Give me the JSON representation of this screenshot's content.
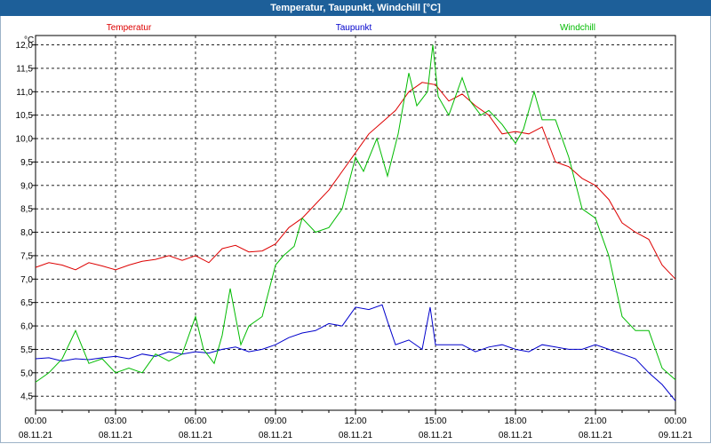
{
  "window": {
    "title": "Temperatur, Taupunkt, Windchill [°C]"
  },
  "chart_data": {
    "type": "line",
    "title": "Temperatur, Taupunkt, Windchill [°C]",
    "ylabel": "°C",
    "ylim": [
      4.2,
      12.2
    ],
    "y_ticks": [
      "4,5",
      "5,0",
      "5,5",
      "6,0",
      "6,5",
      "7,0",
      "7,5",
      "8,0",
      "8,5",
      "9,0",
      "9,5",
      "10,0",
      "10,5",
      "11,0",
      "11,5",
      "12,0"
    ],
    "x_hours_range": [
      0,
      24
    ],
    "x_ticks": [
      {
        "time": "00:00",
        "date": "08.11.21"
      },
      {
        "time": "03:00",
        "date": "08.11.21"
      },
      {
        "time": "06:00",
        "date": "08.11.21"
      },
      {
        "time": "09:00",
        "date": "08.11.21"
      },
      {
        "time": "12:00",
        "date": "08.11.21"
      },
      {
        "time": "15:00",
        "date": "08.11.21"
      },
      {
        "time": "18:00",
        "date": "08.11.21"
      },
      {
        "time": "21:00",
        "date": "08.11.21"
      },
      {
        "time": "00:00",
        "date": "09.11.21"
      }
    ],
    "grid": true,
    "legend_position": "top",
    "series": [
      {
        "name": "Temperatur",
        "color": "#dd0000",
        "x": [
          0,
          0.5,
          1,
          1.5,
          2,
          2.5,
          3,
          3.5,
          4,
          4.5,
          5,
          5.5,
          6,
          6.5,
          7,
          7.5,
          8,
          8.5,
          9,
          9.5,
          10,
          10.5,
          11,
          11.5,
          12,
          12.5,
          13,
          13.5,
          14,
          14.5,
          15,
          15.5,
          16,
          16.5,
          17,
          17.5,
          18,
          18.5,
          19,
          19.5,
          20,
          20.5,
          21,
          21.5,
          22,
          22.5,
          23,
          23.5,
          24
        ],
        "values": [
          7.25,
          7.35,
          7.3,
          7.2,
          7.35,
          7.28,
          7.2,
          7.3,
          7.38,
          7.42,
          7.5,
          7.4,
          7.5,
          7.35,
          7.65,
          7.72,
          7.58,
          7.6,
          7.75,
          8.1,
          8.3,
          8.6,
          8.9,
          9.3,
          9.7,
          10.1,
          10.35,
          10.6,
          11.0,
          11.2,
          11.15,
          10.8,
          10.95,
          10.7,
          10.5,
          10.1,
          10.15,
          10.1,
          10.25,
          9.5,
          9.4,
          9.15,
          9.0,
          8.7,
          8.2,
          8.0,
          7.85,
          7.3,
          7.0
        ]
      },
      {
        "name": "Taupunkt",
        "color": "#0000cc",
        "x": [
          0,
          0.5,
          1,
          1.5,
          2,
          2.5,
          3,
          3.5,
          4,
          4.5,
          5,
          5.5,
          6,
          6.5,
          7,
          7.5,
          8,
          8.5,
          9,
          9.5,
          10,
          10.5,
          11,
          11.5,
          12,
          12.5,
          13,
          13.2,
          13.5,
          14,
          14.5,
          14.8,
          15,
          15.5,
          16,
          16.5,
          17,
          17.5,
          18,
          18.5,
          19,
          19.5,
          20,
          20.5,
          21,
          21.5,
          22,
          22.5,
          23,
          23.5,
          24
        ],
        "values": [
          5.3,
          5.32,
          5.25,
          5.3,
          5.28,
          5.32,
          5.35,
          5.3,
          5.4,
          5.35,
          5.45,
          5.4,
          5.45,
          5.42,
          5.5,
          5.55,
          5.45,
          5.5,
          5.6,
          5.75,
          5.85,
          5.9,
          6.05,
          6.0,
          6.4,
          6.35,
          6.45,
          6.1,
          5.6,
          5.7,
          5.5,
          6.4,
          5.6,
          5.6,
          5.6,
          5.45,
          5.55,
          5.6,
          5.5,
          5.45,
          5.6,
          5.55,
          5.5,
          5.5,
          5.6,
          5.5,
          5.4,
          5.3,
          5.0,
          4.75,
          4.4
        ]
      },
      {
        "name": "Windchill",
        "color": "#00bb00",
        "x": [
          0,
          0.5,
          1,
          1.5,
          2,
          2.5,
          3,
          3.5,
          4,
          4.5,
          5,
          5.5,
          6,
          6.3,
          6.7,
          7,
          7.3,
          7.7,
          8,
          8.5,
          9,
          9.3,
          9.7,
          10,
          10.5,
          11,
          11.5,
          12,
          12.3,
          12.8,
          13.2,
          13.6,
          14,
          14.3,
          14.7,
          14.9,
          15.1,
          15.5,
          16,
          16.3,
          16.7,
          17,
          17.5,
          18,
          18.3,
          18.7,
          19,
          19.5,
          20,
          20.5,
          21,
          21.5,
          22,
          22.5,
          23,
          23.5,
          24
        ],
        "values": [
          4.8,
          5.0,
          5.3,
          5.9,
          5.2,
          5.3,
          5.0,
          5.1,
          5.0,
          5.4,
          5.25,
          5.4,
          6.2,
          5.5,
          5.2,
          5.8,
          6.8,
          5.6,
          6.0,
          6.2,
          7.3,
          7.5,
          7.7,
          8.3,
          8.0,
          8.1,
          8.5,
          9.6,
          9.3,
          10.0,
          9.2,
          10.1,
          11.4,
          10.7,
          11.0,
          12.0,
          10.9,
          10.5,
          11.3,
          10.8,
          10.5,
          10.6,
          10.3,
          9.9,
          10.2,
          11.0,
          10.4,
          10.4,
          9.6,
          8.5,
          8.3,
          7.5,
          6.2,
          5.9,
          5.9,
          5.1,
          4.85
        ]
      }
    ]
  }
}
